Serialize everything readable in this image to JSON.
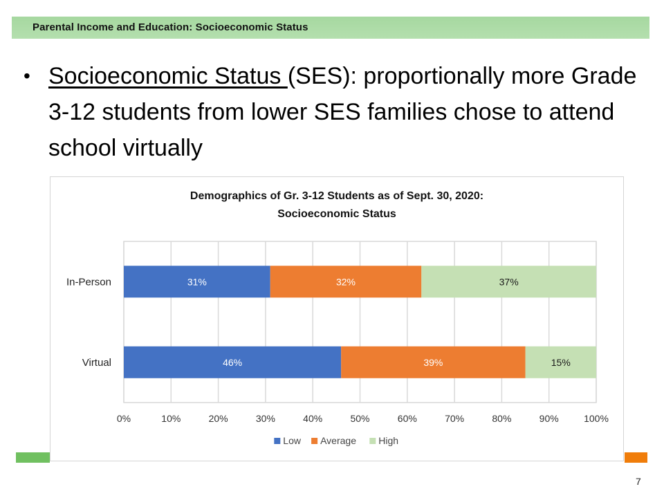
{
  "header": {
    "title": "Parental Income and Education: Socioeconomic Status"
  },
  "bullet": {
    "underlined": "Socioeconomic Status ",
    "rest": "(SES): proportionally more Grade 3-12 students from lower SES families chose to attend school virtually"
  },
  "page_number": "7",
  "colors": {
    "low": "#4472c4",
    "average": "#ed7d31",
    "high": "#c5e0b4",
    "header_band": "#a9d9a3",
    "accent_green": "#70c060",
    "accent_orange": "#f07d0a"
  },
  "chart_data": {
    "type": "bar",
    "orientation": "horizontal",
    "stacked": "percent",
    "title_lines": [
      "Demographics of Gr. 3-12 Students as of Sept. 30, 2020:",
      "Socioeconomic Status"
    ],
    "categories": [
      "In-Person",
      "Virtual"
    ],
    "series": [
      {
        "name": "Low",
        "values": [
          31,
          46
        ],
        "labels": [
          "31%",
          "46%"
        ]
      },
      {
        "name": "Average",
        "values": [
          32,
          39
        ],
        "labels": [
          "32%",
          "39%"
        ]
      },
      {
        "name": "High",
        "values": [
          37,
          15
        ],
        "labels": [
          "37%",
          "15%"
        ]
      }
    ],
    "xlim": [
      0,
      100
    ],
    "xticks": [
      "0%",
      "10%",
      "20%",
      "30%",
      "40%",
      "50%",
      "60%",
      "70%",
      "80%",
      "90%",
      "100%"
    ],
    "grid": true,
    "legend": "bottom",
    "xlabel": "",
    "ylabel": ""
  }
}
